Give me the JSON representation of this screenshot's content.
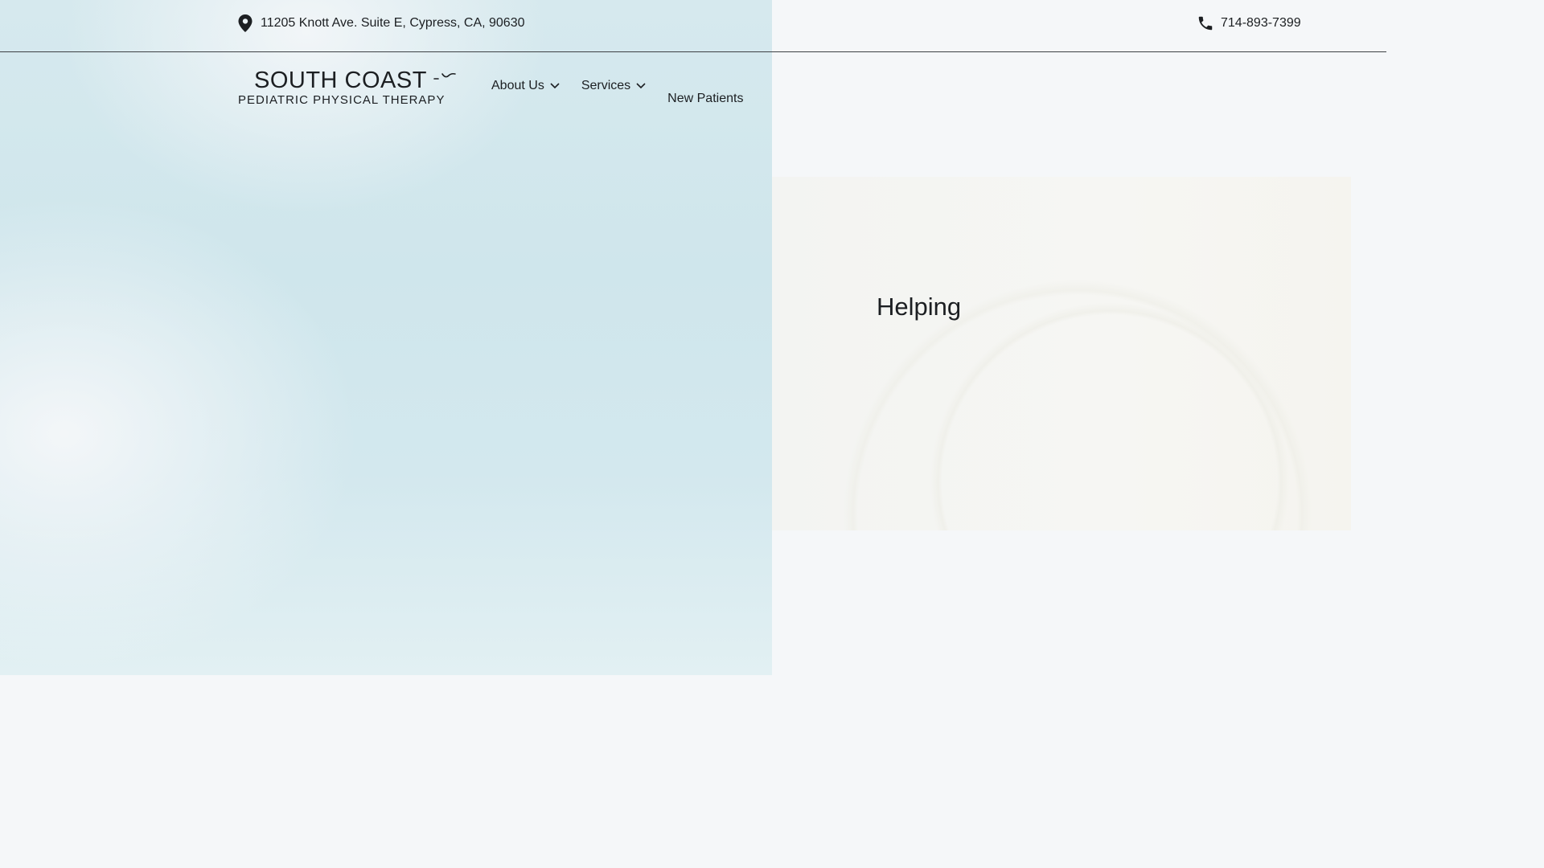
{
  "topbar": {
    "address": "11205 Knott Ave. Suite E, Cypress, CA, 90630",
    "phone": "714-893-7399",
    "icons": {
      "address": "map-pin-icon",
      "phone": "phone-icon"
    }
  },
  "logo": {
    "title": "SOUTH COAST",
    "subtitle": "PEDIATRIC PHYSICAL THERAPY"
  },
  "nav": {
    "items": [
      {
        "label": "About Us",
        "has_dropdown": true
      },
      {
        "label": "Services",
        "has_dropdown": true
      },
      {
        "label": "New Patients",
        "has_dropdown": false
      }
    ]
  },
  "hero": {
    "heading": "Helping"
  },
  "colors": {
    "text": "#1c1f22",
    "background": "#f5f7f9",
    "overlay_teal": "#cfe6ec"
  }
}
